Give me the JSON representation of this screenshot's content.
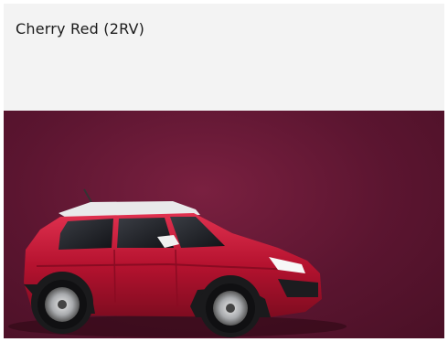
{
  "color_option": {
    "name": "Cherry Red (2RV)",
    "code": "2RV",
    "paint_hex": "#b5122f",
    "background_hex": "#5b1530"
  }
}
